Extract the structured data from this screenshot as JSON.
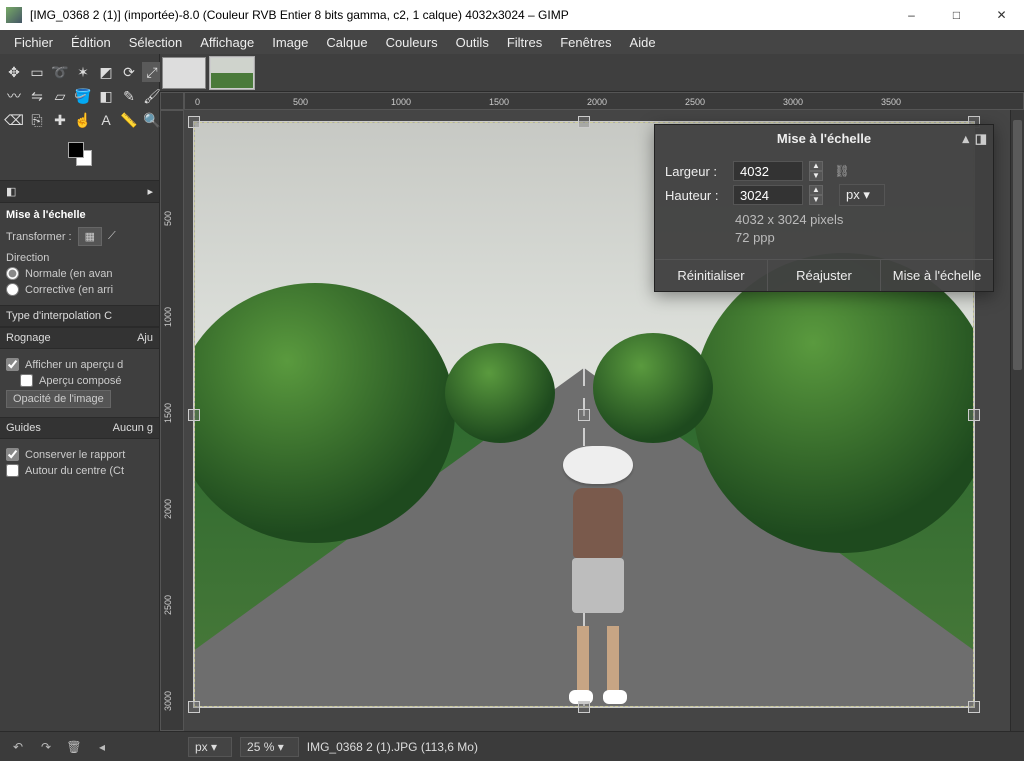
{
  "titlebar": {
    "title": "[IMG_0368 2 (1)] (importée)-8.0 (Couleur RVB Entier 8 bits gamma, c2, 1 calque) 4032x3024 – GIMP"
  },
  "menu": {
    "items": [
      "Fichier",
      "Édition",
      "Sélection",
      "Affichage",
      "Image",
      "Calque",
      "Couleurs",
      "Outils",
      "Filtres",
      "Fenêtres",
      "Aide"
    ]
  },
  "toolbox": {
    "tools": [
      "move",
      "rect-select",
      "lasso",
      "wand",
      "crop",
      "rotate",
      "scale",
      "warp",
      "flip",
      "perspective",
      "bucket",
      "gradient",
      "pencil",
      "brush",
      "eraser",
      "clone",
      "heal",
      "smudge",
      "text",
      "measure",
      "zoom",
      "color-pick"
    ]
  },
  "tool_options": {
    "title": "Mise à l'échelle",
    "transform_label": "Transformer :",
    "direction_label": "Direction",
    "direction_normal": "Normale (en avan",
    "direction_corrective": "Corrective (en arri",
    "interpolation_label": "Type d'interpolation C",
    "crop_label": "Rognage",
    "crop_value": "Aju",
    "preview_label": "Afficher un aperçu d",
    "composite_label": "Aperçu composé",
    "opacity_label": "Opacité de l'image",
    "guides_label": "Guides",
    "guides_value": "Aucun g",
    "keep_ratio": "Conserver le rapport",
    "around_center": "Autour du centre (Ct"
  },
  "dialog": {
    "title": "Mise à l'échelle",
    "width_label": "Largeur :",
    "height_label": "Hauteur :",
    "width": "4032",
    "height": "3024",
    "unit": "px",
    "info_size": "4032 x 3024 pixels",
    "info_res": "72 ppp",
    "btn_reset": "Réinitialiser",
    "btn_adjust": "Réajuster",
    "btn_scale": "Mise à l'échelle"
  },
  "status": {
    "unit": "px",
    "zoom": "25 %",
    "filename": "IMG_0368 2 (1).JPG (113,6 Mo)"
  },
  "ruler": {
    "marks": [
      "0",
      "500",
      "1000",
      "1500",
      "2000",
      "2500",
      "3000",
      "3500"
    ],
    "vmarks": [
      "500",
      "1000",
      "1500",
      "2000",
      "2500",
      "3000"
    ]
  },
  "collapse_icon": "▸"
}
